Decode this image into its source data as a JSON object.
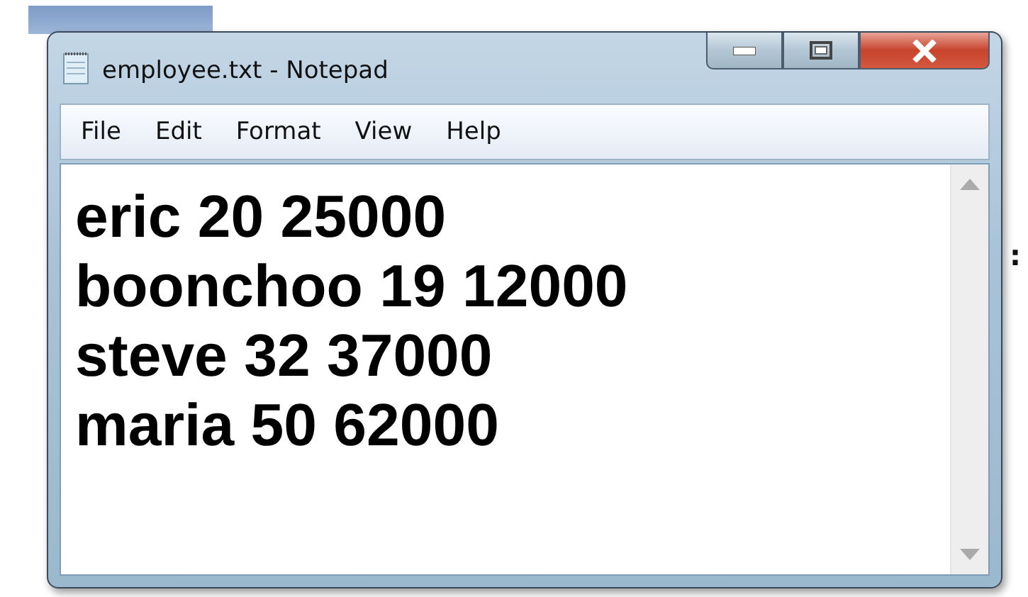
{
  "window": {
    "title": "employee.txt - Notepad"
  },
  "menu": [
    "File",
    "Edit",
    "Format",
    "View",
    "Help"
  ],
  "lines": [
    "eric 20 25000",
    "boonchoo 19 12000",
    "steve 32 37000",
    "maria 50 62000"
  ],
  "background_text": ":"
}
